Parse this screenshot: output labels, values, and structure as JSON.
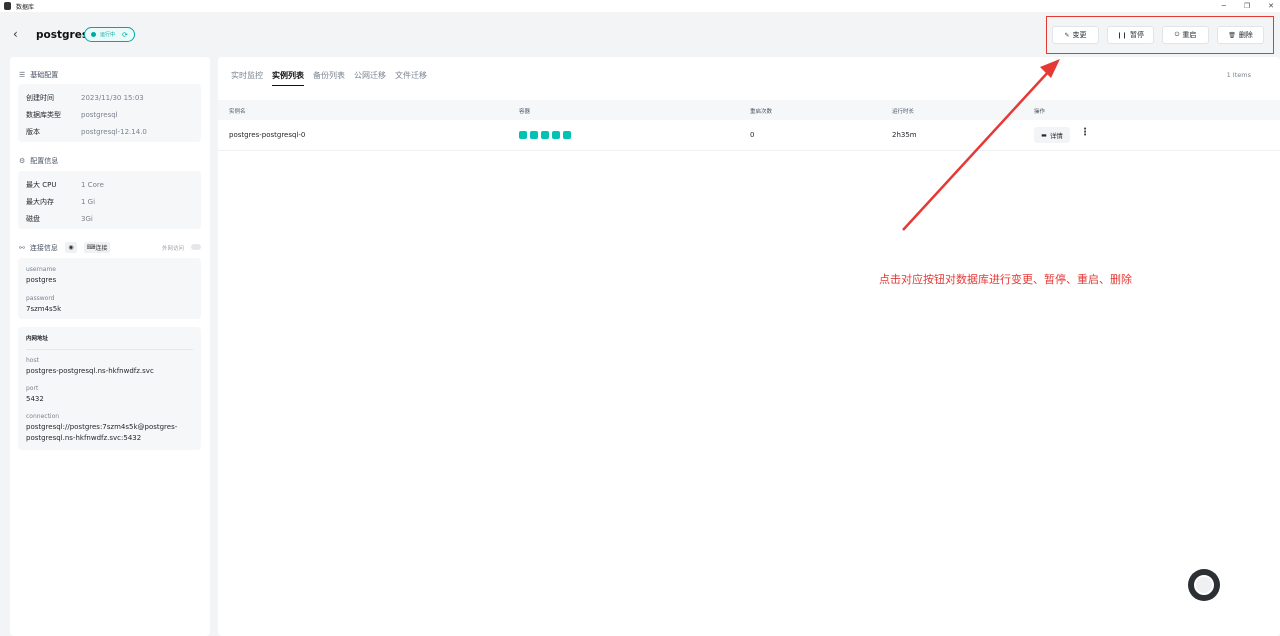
{
  "window": {
    "title": "数据库"
  },
  "header": {
    "db_name": "postgres",
    "status": "运行中",
    "actions": [
      {
        "label": "变更",
        "icon": "edit-icon"
      },
      {
        "label": "暂停",
        "icon": "pause-icon"
      },
      {
        "label": "重启",
        "icon": "restart-icon"
      },
      {
        "label": "删除",
        "icon": "trash-icon"
      }
    ]
  },
  "sidebar": {
    "basic": {
      "title": "基础配置",
      "rows": [
        {
          "k": "创建时间",
          "v": "2023/11/30 15:03"
        },
        {
          "k": "数据库类型",
          "v": "postgresql"
        },
        {
          "k": "版本",
          "v": "postgresql-12.14.0"
        }
      ]
    },
    "config": {
      "title": "配置信息",
      "rows": [
        {
          "k": "最大 CPU",
          "v": "1 Core"
        },
        {
          "k": "最大内存",
          "v": "1 Gi"
        },
        {
          "k": "磁盘",
          "v": "3Gi"
        }
      ]
    },
    "connection": {
      "title": "连接信息",
      "connect_label": "连接",
      "external_label": "外网访问",
      "username_label": "username",
      "username": "postgres",
      "password_label": "password",
      "password": "7szm4s5k"
    },
    "internal": {
      "title": "内网地址",
      "host_label": "host",
      "host": "postgres-postgresql.ns-hkfnwdfz.svc",
      "port_label": "port",
      "port": "5432",
      "connection_label": "connection",
      "connection_line1": "postgresql://postgres:7szm4s5k@postgres-",
      "connection_line2": "postgresql.ns-hkfnwdfz.svc:5432"
    }
  },
  "main": {
    "tabs": [
      "实时监控",
      "实例列表",
      "备份列表",
      "公网迁移",
      "文件迁移"
    ],
    "active_tab": 1,
    "items_count": "1 Items",
    "columns": [
      "实例名",
      "容器",
      "重启次数",
      "运行时长",
      "操作"
    ],
    "rows": [
      {
        "name": "postgres-postgresql-0",
        "containers": 5,
        "restarts": "0",
        "uptime": "2h35m",
        "detail_label": "详情"
      }
    ]
  },
  "annotation": {
    "text": "点击对应按钮对数据库进行变更、暂停、重启、删除",
    "color": "#e53935"
  }
}
